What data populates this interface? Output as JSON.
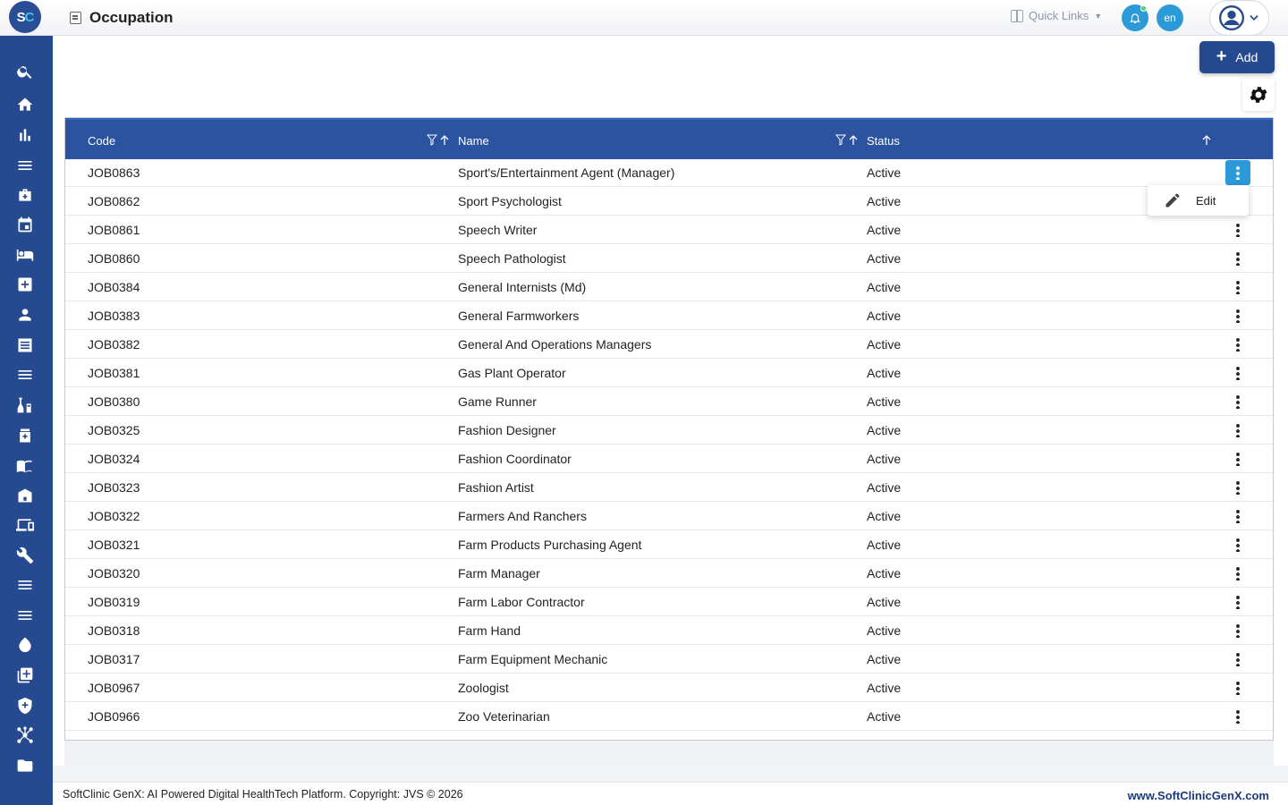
{
  "header": {
    "logo_left": "S",
    "logo_right": "C",
    "page_title": "Occupation",
    "quick_links": "Quick Links",
    "language": "en"
  },
  "sidebar": {
    "icons": [
      "search-icon",
      "home-icon",
      "bar-chart-icon",
      "menu-icon",
      "medical-bag-icon",
      "calendar-icon",
      "bed-icon",
      "medical-cross-icon",
      "person-icon",
      "list-document-icon",
      "menu-icon",
      "lab-flask-icon",
      "pharmacy-icon",
      "book-icon",
      "store-icon",
      "devices-icon",
      "wrench-icon",
      "menu-icon",
      "menu-icon",
      "drop-icon",
      "add-box-icon",
      "shield-icon",
      "network-icon",
      "folder-icon"
    ]
  },
  "toolbar": {
    "add_label": "Add"
  },
  "table": {
    "columns": [
      "Code",
      "Name",
      "Status"
    ],
    "rows": [
      {
        "code": "JOB0863",
        "name": "Sport's/Entertainment Agent (Manager)",
        "status": "Active"
      },
      {
        "code": "JOB0862",
        "name": "Sport Psychologist",
        "status": "Active"
      },
      {
        "code": "JOB0861",
        "name": "Speech Writer",
        "status": "Active"
      },
      {
        "code": "JOB0860",
        "name": "Speech Pathologist",
        "status": "Active"
      },
      {
        "code": "JOB0384",
        "name": "General Internists (Md)",
        "status": "Active"
      },
      {
        "code": "JOB0383",
        "name": "General Farmworkers",
        "status": "Active"
      },
      {
        "code": "JOB0382",
        "name": "General And Operations Managers",
        "status": "Active"
      },
      {
        "code": "JOB0381",
        "name": "Gas Plant Operator",
        "status": "Active"
      },
      {
        "code": "JOB0380",
        "name": "Game Runner",
        "status": "Active"
      },
      {
        "code": "JOB0325",
        "name": "Fashion Designer",
        "status": "Active"
      },
      {
        "code": "JOB0324",
        "name": "Fashion Coordinator",
        "status": "Active"
      },
      {
        "code": "JOB0323",
        "name": "Fashion Artist",
        "status": "Active"
      },
      {
        "code": "JOB0322",
        "name": "Farmers And Ranchers",
        "status": "Active"
      },
      {
        "code": "JOB0321",
        "name": "Farm Products Purchasing Agent",
        "status": "Active"
      },
      {
        "code": "JOB0320",
        "name": "Farm Manager",
        "status": "Active"
      },
      {
        "code": "JOB0319",
        "name": "Farm Labor Contractor",
        "status": "Active"
      },
      {
        "code": "JOB0318",
        "name": "Farm Hand",
        "status": "Active"
      },
      {
        "code": "JOB0317",
        "name": "Farm Equipment Mechanic",
        "status": "Active"
      },
      {
        "code": "JOB0967",
        "name": "Zoologist",
        "status": "Active"
      },
      {
        "code": "JOB0966",
        "name": "Zoo Veterinarian",
        "status": "Active"
      }
    ]
  },
  "row_menu": {
    "edit_label": "Edit"
  },
  "footer": {
    "copyright": "SoftClinic GenX: AI Powered Digital HealthTech Platform. Copyright: JVS © 2026",
    "website": "www.SoftClinicGenX.com"
  },
  "colors": {
    "primary": "#264a8f",
    "table_header": "#2b53a0",
    "accent": "#2c9ad8"
  }
}
